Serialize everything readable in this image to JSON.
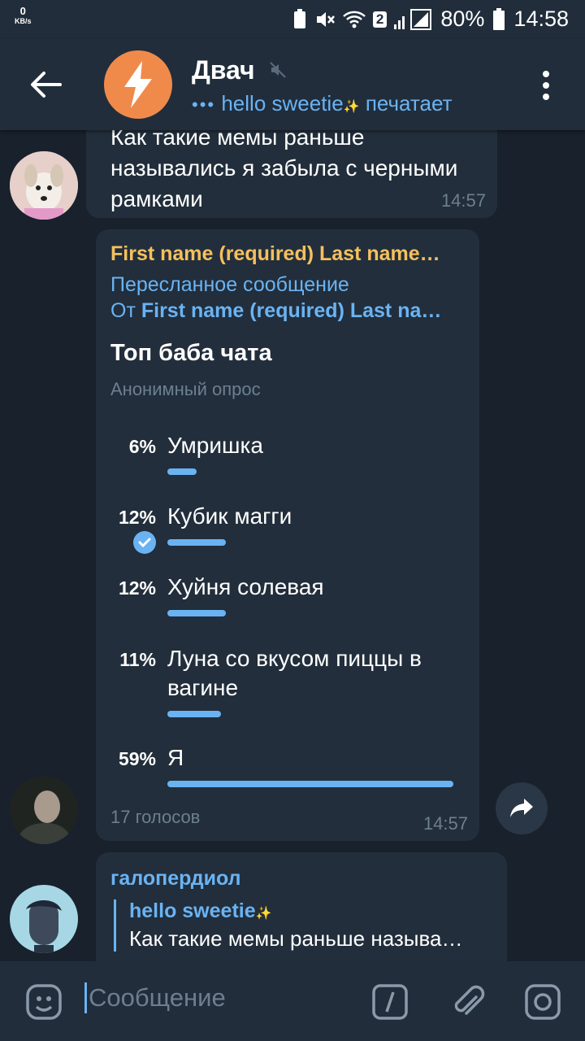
{
  "status_bar": {
    "net_speed": "0",
    "net_speed_unit": "KB/s",
    "sim_badge": "2",
    "battery": "80%",
    "time": "14:58"
  },
  "header": {
    "title": "Двач",
    "status_prefix": "•••",
    "status_user": "hello sweetie",
    "status_action": "печатает"
  },
  "messages": {
    "msg1": {
      "text": "Как такие мемы раньше назывались я забыла с черными рамками",
      "time": "14:57"
    },
    "poll": {
      "forward_name": "First name (required) Last name…",
      "forward_label": "Пересланное сообщение",
      "forward_from_prefix": "От",
      "forward_from_name": "First name (required) Last na…",
      "question": "Топ баба чата",
      "type": "Анонимный опрос",
      "options": [
        {
          "percent_text": "6%",
          "label": "Умришка",
          "value": 0.06,
          "chosen": false
        },
        {
          "percent_text": "12%",
          "label": "Кубик магги",
          "value": 0.12,
          "chosen": true
        },
        {
          "percent_text": "12%",
          "label": "Хуйня солевая",
          "value": 0.12,
          "chosen": false
        },
        {
          "percent_text": "11%",
          "label": "Луна со вкусом пиццы в вагине",
          "value": 0.11,
          "chosen": false
        },
        {
          "percent_text": "59%",
          "label": "Я",
          "value": 0.59,
          "chosen": false
        }
      ],
      "votes": "17 голосов",
      "time": "14:57"
    },
    "msg3": {
      "sender": "галопердиол",
      "reply_name": "hello sweetie",
      "reply_text": "Как такие мемы раньше называ…"
    }
  },
  "input": {
    "placeholder": "Сообщение"
  },
  "colors": {
    "accent": "#6ab3f3",
    "forward_name": "#f5c05e",
    "bubble": "#222e3b",
    "background": "#18212c"
  }
}
